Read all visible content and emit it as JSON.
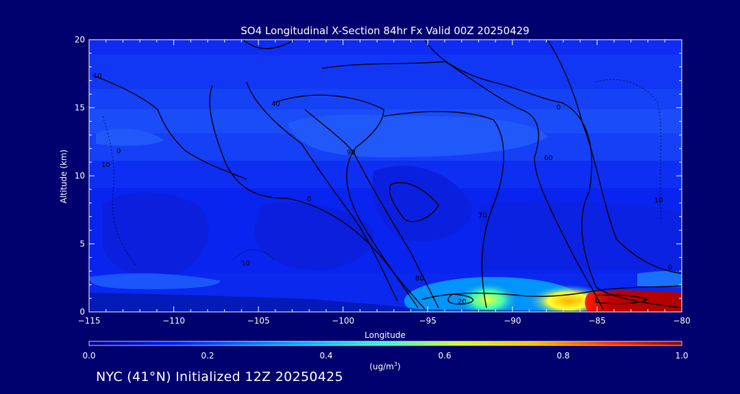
{
  "chart_data": {
    "type": "heatmap",
    "title": "SO4 Longitudinal X-Section 84hr  Fx Valid 00Z 20250429",
    "xlabel": "Longitude",
    "ylabel": "Altitude (km)",
    "xlim": [
      -115,
      -80
    ],
    "ylim": [
      0,
      20
    ],
    "x_ticks": [
      -115,
      -110,
      -105,
      -100,
      -95,
      -90,
      -85,
      -80
    ],
    "y_ticks": [
      0,
      5,
      10,
      15,
      20
    ],
    "colorbar": {
      "min": 0.0,
      "max": 1.0,
      "ticks": [
        "0.0",
        "0.2",
        "0.4",
        "0.6",
        "0.8",
        "1.0"
      ],
      "units_label": "(ug/m",
      "units_exp": "3",
      "units_tail": ")"
    },
    "contour_labels": [
      "0",
      "20",
      "40",
      "60",
      "70",
      "80",
      "90",
      "10"
    ],
    "notable_values": [
      {
        "lon": -91,
        "alt": 0.8,
        "value": 0.55,
        "note": "yellow-green plume"
      },
      {
        "lon": -88,
        "alt": 0.8,
        "value": 0.7
      },
      {
        "lon": -84,
        "alt": 0.8,
        "value": 1.0,
        "note": "dark red maximum"
      },
      {
        "lon": -81,
        "alt": 0.9,
        "value": 0.95
      }
    ],
    "grid": false
  },
  "footer": "NYC (41°N) Initialized 12Z 20250425",
  "colors": {
    "background": "#00006e",
    "plot_background": "#0a1ff0",
    "contour": "#000000"
  }
}
